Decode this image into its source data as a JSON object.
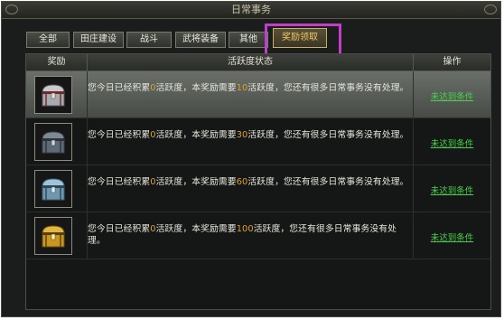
{
  "window": {
    "title": "日常事务"
  },
  "tabs": [
    {
      "label": "全部",
      "active": false
    },
    {
      "label": "田庄建设",
      "active": false
    },
    {
      "label": "战斗",
      "active": false
    },
    {
      "label": "武将装备",
      "active": false
    },
    {
      "label": "其他",
      "active": false
    },
    {
      "label": "奖励领取",
      "active": true
    }
  ],
  "table": {
    "headers": {
      "reward": "奖励",
      "status": "活跃度状态",
      "action": "操作"
    },
    "rows": [
      {
        "chest": "silver-chest-icon",
        "desc_prefix": "您今日已经积累",
        "accumulated": "0",
        "desc_mid": "活跃度，本奖励需要",
        "required": "10",
        "desc_suffix": "活跃度，您还有很多日常事务没有处理。",
        "action": "未达到条件"
      },
      {
        "chest": "steel-chest-icon",
        "desc_prefix": "您今日已经积累",
        "accumulated": "0",
        "desc_mid": "活跃度，本奖励需要",
        "required": "30",
        "desc_suffix": "活跃度，您还有很多日常事务没有处理。",
        "action": "未达到条件"
      },
      {
        "chest": "blue-chest-icon",
        "desc_prefix": "您今日已经积累",
        "accumulated": "0",
        "desc_mid": "活跃度，本奖励需要",
        "required": "60",
        "desc_suffix": "活跃度，您还有很多日常事务没有处理。",
        "action": "未达到条件"
      },
      {
        "chest": "gold-chest-icon",
        "desc_prefix": "您今日已经积累",
        "accumulated": "0",
        "desc_mid": "活跃度，本奖励需要",
        "required": "100",
        "desc_suffix": "活跃度，您还有很多日常事务没有处理。",
        "action": "未达到条件"
      }
    ]
  },
  "colors": {
    "accent_number": "#e0a030",
    "action_link": "#4bd14f",
    "highlight_box": "#c13fc8",
    "active_tab_text": "#f4c86a"
  }
}
